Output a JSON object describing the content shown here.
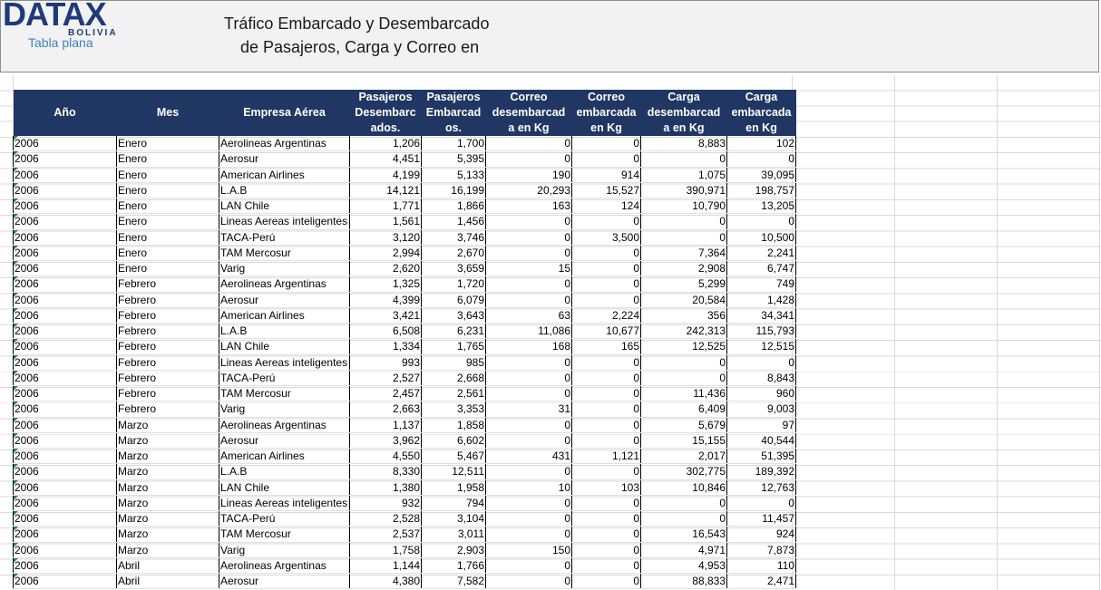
{
  "logo": {
    "main": "DATAX",
    "country": "BOLIVIA",
    "subtitle": "Tabla plana"
  },
  "title": {
    "line1": "Tráfico Embarcado y Desembarcado",
    "line2": "de Pasajeros, Carga y Correo en"
  },
  "columns": [
    [
      "Año"
    ],
    [
      "Mes"
    ],
    [
      "Empresa Aérea"
    ],
    [
      "Pasajeros",
      "Desembarc",
      "ados."
    ],
    [
      "Pasajeros",
      "Embarcad",
      "os."
    ],
    [
      "Correo",
      "desembarcad",
      "a en Kg"
    ],
    [
      "Correo",
      "embarcada",
      "en Kg"
    ],
    [
      "Carga",
      "desembarcad",
      "a en Kg"
    ],
    [
      "Carga",
      "embarcada",
      "en Kg"
    ]
  ],
  "rows": [
    [
      "2006",
      "Enero",
      "Aerolineas Argentinas",
      "1,206",
      "1,700",
      "0",
      "0",
      "8,883",
      "102"
    ],
    [
      "2006",
      "Enero",
      "Aerosur",
      "4,451",
      "5,395",
      "0",
      "0",
      "0",
      "0"
    ],
    [
      "2006",
      "Enero",
      "American Airlines",
      "4,199",
      "5,133",
      "190",
      "914",
      "1,075",
      "39,095"
    ],
    [
      "2006",
      "Enero",
      "L.A.B",
      "14,121",
      "16,199",
      "20,293",
      "15,527",
      "390,971",
      "198,757"
    ],
    [
      "2006",
      "Enero",
      "LAN Chile",
      "1,771",
      "1,866",
      "163",
      "124",
      "10,790",
      "13,205"
    ],
    [
      "2006",
      "Enero",
      "Lineas Aereas inteligentes",
      "1,561",
      "1,456",
      "0",
      "0",
      "0",
      "0"
    ],
    [
      "2006",
      "Enero",
      "TACA-Perú",
      "3,120",
      "3,746",
      "0",
      "3,500",
      "0",
      "10,500"
    ],
    [
      "2006",
      "Enero",
      "TAM Mercosur",
      "2,994",
      "2,670",
      "0",
      "0",
      "7,364",
      "2,241"
    ],
    [
      "2006",
      "Enero",
      "Varig",
      "2,620",
      "3,659",
      "15",
      "0",
      "2,908",
      "6,747"
    ],
    [
      "2006",
      "Febrero",
      "Aerolineas Argentinas",
      "1,325",
      "1,720",
      "0",
      "0",
      "5,299",
      "749"
    ],
    [
      "2006",
      "Febrero",
      "Aerosur",
      "4,399",
      "6,079",
      "0",
      "0",
      "20,584",
      "1,428"
    ],
    [
      "2006",
      "Febrero",
      "American Airlines",
      "3,421",
      "3,643",
      "63",
      "2,224",
      "356",
      "34,341"
    ],
    [
      "2006",
      "Febrero",
      "L.A.B",
      "6,508",
      "6,231",
      "11,086",
      "10,677",
      "242,313",
      "115,793"
    ],
    [
      "2006",
      "Febrero",
      "LAN Chile",
      "1,334",
      "1,765",
      "168",
      "165",
      "12,525",
      "12,515"
    ],
    [
      "2006",
      "Febrero",
      "Lineas Aereas inteligentes",
      "993",
      "985",
      "0",
      "0",
      "0",
      "0"
    ],
    [
      "2006",
      "Febrero",
      "TACA-Perú",
      "2,527",
      "2,668",
      "0",
      "0",
      "0",
      "8,843"
    ],
    [
      "2006",
      "Febrero",
      "TAM Mercosur",
      "2,457",
      "2,561",
      "0",
      "0",
      "11,436",
      "960"
    ],
    [
      "2006",
      "Febrero",
      "Varig",
      "2,663",
      "3,353",
      "31",
      "0",
      "6,409",
      "9,003"
    ],
    [
      "2006",
      "Marzo",
      "Aerolineas Argentinas",
      "1,137",
      "1,858",
      "0",
      "0",
      "5,679",
      "97"
    ],
    [
      "2006",
      "Marzo",
      "Aerosur",
      "3,962",
      "6,602",
      "0",
      "0",
      "15,155",
      "40,544"
    ],
    [
      "2006",
      "Marzo",
      "American Airlines",
      "4,550",
      "5,467",
      "431",
      "1,121",
      "2,017",
      "51,395"
    ],
    [
      "2006",
      "Marzo",
      "L.A.B",
      "8,330",
      "12,511",
      "0",
      "0",
      "302,775",
      "189,392"
    ],
    [
      "2006",
      "Marzo",
      "LAN Chile",
      "1,380",
      "1,958",
      "10",
      "103",
      "10,846",
      "12,763"
    ],
    [
      "2006",
      "Marzo",
      "Lineas Aereas inteligentes",
      "932",
      "794",
      "0",
      "0",
      "0",
      "0"
    ],
    [
      "2006",
      "Marzo",
      "TACA-Perú",
      "2,528",
      "3,104",
      "0",
      "0",
      "0",
      "11,457"
    ],
    [
      "2006",
      "Marzo",
      "TAM Mercosur",
      "2,537",
      "3,011",
      "0",
      "0",
      "16,543",
      "924"
    ],
    [
      "2006",
      "Marzo",
      "Varig",
      "1,758",
      "2,903",
      "150",
      "0",
      "4,971",
      "7,873"
    ],
    [
      "2006",
      "Abril",
      "Aerolineas Argentinas",
      "1,144",
      "1,766",
      "0",
      "0",
      "4,953",
      "110"
    ],
    [
      "2006",
      "Abril",
      "Aerosur",
      "4,380",
      "7,582",
      "0",
      "0",
      "88,833",
      "2,471"
    ]
  ],
  "colors": {
    "header_bg": "#203764",
    "header_text": "#ffffff",
    "banner_bg": "#f2f2f2",
    "logo": "#1f3a7a",
    "error_triangle": "#2e8b3e"
  }
}
